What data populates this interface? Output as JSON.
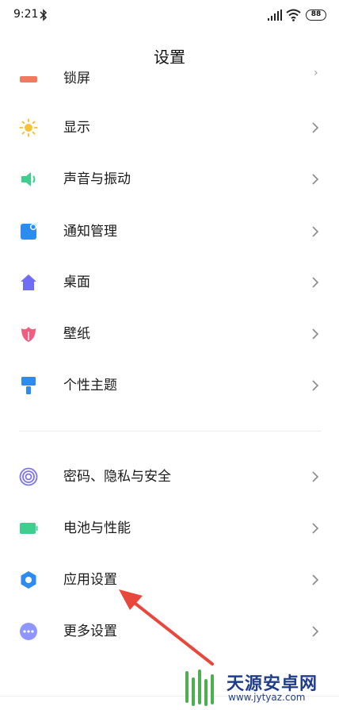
{
  "status_bar": {
    "time": "9:21",
    "battery": "88",
    "icons": [
      "bluetooth-icon",
      "signal-icon",
      "wifi-icon",
      "battery-icon"
    ]
  },
  "header": {
    "title": "设置"
  },
  "partial_item": {
    "label": "锁屏",
    "icon": "lock-screen-icon",
    "color": "#f07a60"
  },
  "menu": [
    {
      "label": "显示",
      "icon": "sun-icon",
      "color": "#f6c23a"
    },
    {
      "label": "声音与振动",
      "icon": "speaker-icon",
      "color": "#3ecf8e"
    },
    {
      "label": "通知管理",
      "icon": "notification-icon",
      "color": "#2d8cf0"
    },
    {
      "label": "桌面",
      "icon": "home-icon",
      "color": "#6f6cf5"
    },
    {
      "label": "壁纸",
      "icon": "tulip-icon",
      "color": "#f05d7e"
    },
    {
      "label": "个性主题",
      "icon": "brush-icon",
      "color": "#2d8cf0"
    },
    {
      "label": "密码、隐私与安全",
      "icon": "fingerprint-icon",
      "color": "#7b74f0"
    },
    {
      "label": "电池与性能",
      "icon": "battery-icon",
      "color": "#3ecf8e"
    },
    {
      "label": "应用设置",
      "icon": "gear-icon",
      "color": "#2d8cf0"
    },
    {
      "label": "更多设置",
      "icon": "more-icon",
      "color": "#8e96ff"
    }
  ],
  "annotation": {
    "arrow_color": "#e8473b",
    "points_to": "应用设置"
  },
  "watermark": {
    "title": "天源安卓网",
    "url": "www.jytyaz.com",
    "color": "#1f3d8a"
  }
}
